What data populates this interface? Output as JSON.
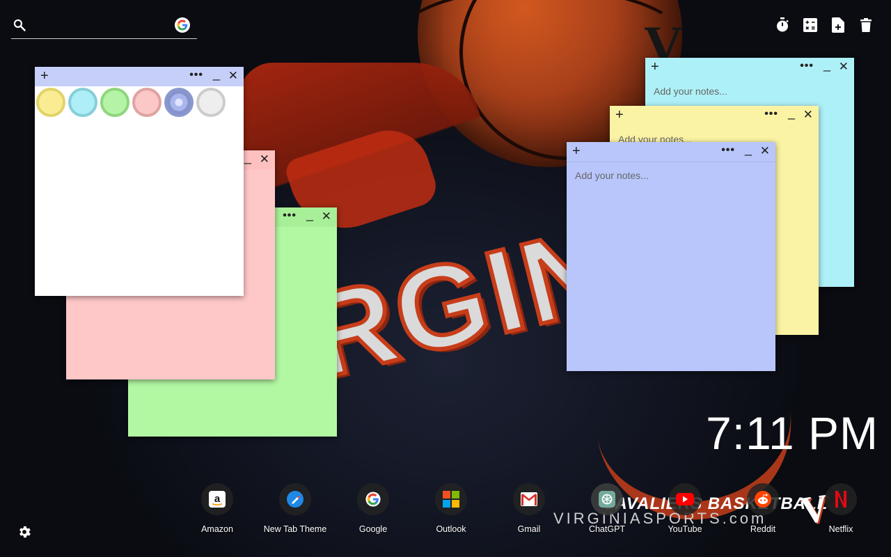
{
  "wallpaper": {
    "jersey_text": "RGINI",
    "watermark_top": "CAVALIERS BASKETBALL",
    "watermark_bottom": "VIRGINIASPORTS.com"
  },
  "search": {
    "value": "",
    "placeholder": "",
    "search_icon": "search-icon",
    "engine_icon": "google-icon"
  },
  "toolbar": {
    "items": [
      {
        "name": "timer",
        "icon": "stopwatch-icon"
      },
      {
        "name": "calculator",
        "icon": "calculator-icon"
      },
      {
        "name": "new-note",
        "icon": "new-note-icon"
      },
      {
        "name": "delete",
        "icon": "trash-icon"
      }
    ]
  },
  "notes": [
    {
      "id": "palette",
      "color": "#ffffff",
      "header_color": "#c6cff8",
      "add": "+",
      "more": "•••",
      "min": "_",
      "close": "✕"
    },
    {
      "id": "pink",
      "color": "#ffc8c8",
      "header_color": "#ffc0c0",
      "add": "+",
      "more": "•••",
      "min": "_",
      "close": "✕",
      "placeholder": ""
    },
    {
      "id": "green",
      "color": "#b2f8a2",
      "header_color": "#a8f098",
      "add": "+",
      "more": "•••",
      "min": "_",
      "close": "✕",
      "placeholder": ""
    },
    {
      "id": "cyan",
      "color": "#aef0f7",
      "add": "+",
      "more": "•••",
      "min": "_",
      "close": "✕",
      "placeholder": "Add your notes..."
    },
    {
      "id": "yellow",
      "color": "#fbf3a4",
      "add": "+",
      "more": "•••",
      "min": "_",
      "close": "✕",
      "placeholder": "Add your notes..."
    },
    {
      "id": "blue",
      "color": "#b8c6fb",
      "add": "+",
      "more": "•••",
      "min": "_",
      "close": "✕",
      "placeholder": "Add your notes..."
    }
  ],
  "palette_colors": [
    {
      "name": "yellow",
      "fill": "#f9ec93",
      "ring": "#e2d36a"
    },
    {
      "name": "cyan",
      "fill": "#aeeef6",
      "ring": "#86cfd9"
    },
    {
      "name": "green",
      "fill": "#b5f4a6",
      "ring": "#8fd67e"
    },
    {
      "name": "pink",
      "fill": "#fbc7c7",
      "ring": "#e0a3a3"
    },
    {
      "name": "blue",
      "fill": "#a9b6ee",
      "ring": "#8a98cf"
    },
    {
      "name": "white",
      "fill": "#eeeeee",
      "ring": "#cccccc"
    }
  ],
  "clock": {
    "time": "7:11 PM"
  },
  "dock": [
    {
      "label": "Amazon",
      "icon": "amazon-icon"
    },
    {
      "label": "New Tab Theme",
      "icon": "new-tab-theme-icon"
    },
    {
      "label": "Google",
      "icon": "google-icon"
    },
    {
      "label": "Outlook",
      "icon": "microsoft-icon"
    },
    {
      "label": "Gmail",
      "icon": "gmail-icon"
    },
    {
      "label": "ChatGPT",
      "icon": "chatgpt-icon"
    },
    {
      "label": "YouTube",
      "icon": "youtube-icon"
    },
    {
      "label": "Reddit",
      "icon": "reddit-icon"
    },
    {
      "label": "Netflix",
      "icon": "netflix-icon"
    }
  ],
  "settings": {
    "icon": "gear-icon"
  }
}
